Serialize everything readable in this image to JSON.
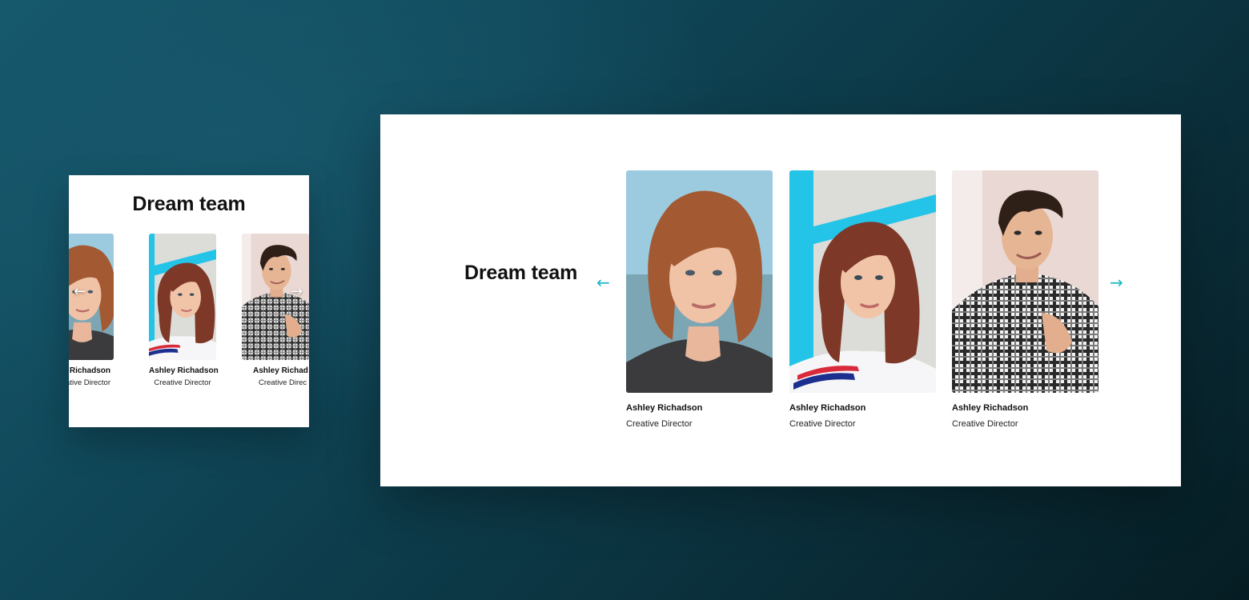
{
  "colors": {
    "accent": "#17b8c6",
    "panel": "#ffffff",
    "background": "#0f4556"
  },
  "mobile": {
    "heading": "Dream team",
    "prev_icon": "arrow-left-icon",
    "next_icon": "arrow-right-icon",
    "prev_glyph": "←",
    "next_glyph": "→",
    "members": [
      {
        "name": "Ashley Richadson",
        "name_visible": "ey Richadson",
        "role": "Creative Director",
        "role_visible": "ative Director",
        "photo": "red-haired-woman-photo"
      },
      {
        "name": "Ashley Richadson",
        "name_visible": "Ashley Richadson",
        "role": "Creative Director",
        "role_visible": "Creative Director",
        "photo": "woman-blue-wall-photo"
      },
      {
        "name": "Ashley Richadson",
        "name_visible": "Ashley Richad",
        "role": "Creative Director",
        "role_visible": "Creative Direc",
        "photo": "man-plaid-shirt-photo"
      }
    ]
  },
  "desktop": {
    "heading": "Dream team",
    "prev_icon": "arrow-left-icon",
    "next_icon": "arrow-right-icon",
    "prev_glyph": "←",
    "next_glyph": "→",
    "members": [
      {
        "name": "Ashley Richadson",
        "role": "Creative Director",
        "photo": "red-haired-woman-photo"
      },
      {
        "name": "Ashley Richadson",
        "role": "Creative Director",
        "photo": "woman-blue-wall-photo"
      },
      {
        "name": "Ashley Richadson",
        "role": "Creative Director",
        "photo": "man-plaid-shirt-photo"
      }
    ]
  }
}
